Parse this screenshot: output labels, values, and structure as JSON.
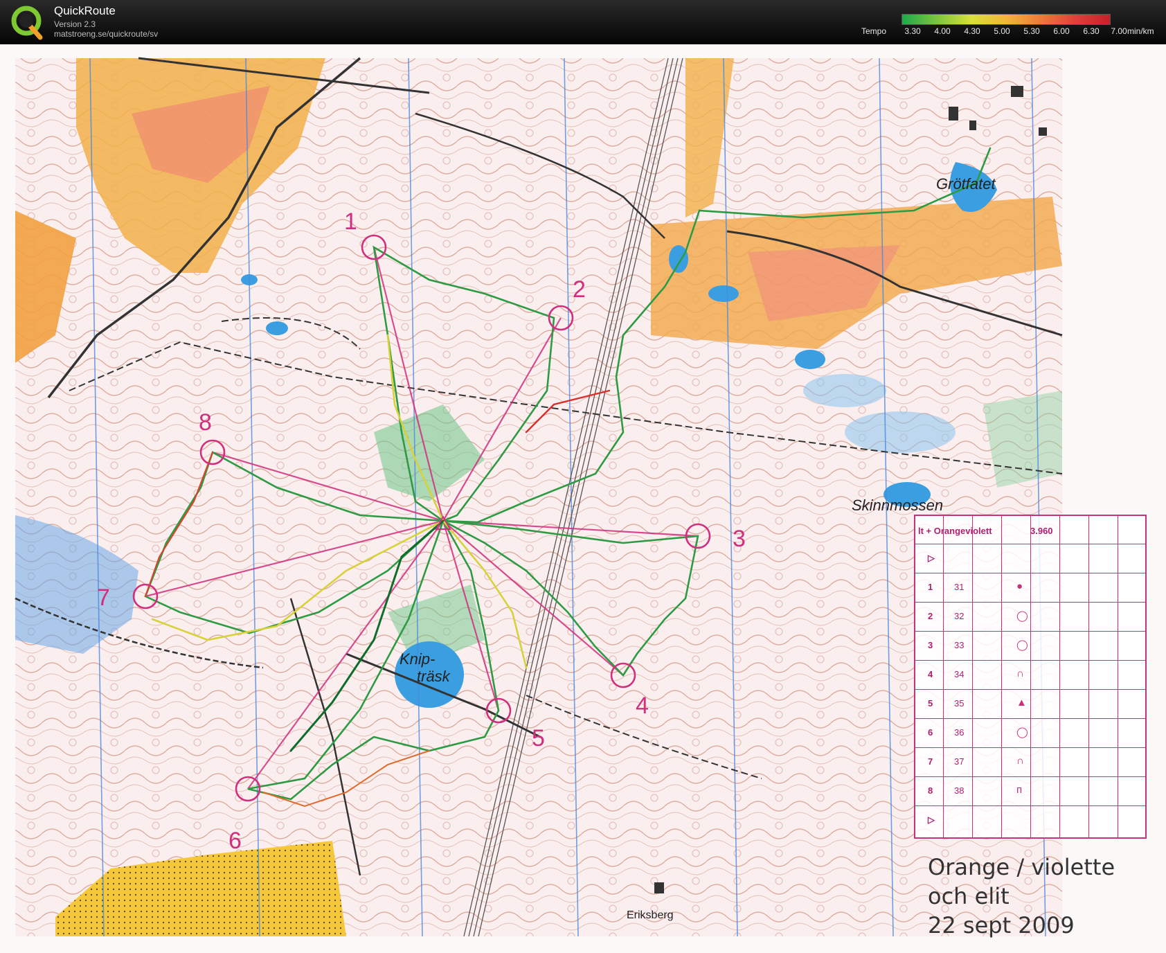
{
  "app": {
    "title": "QuickRoute",
    "version": "Version 2.3",
    "url": "matstroeng.se/quickroute/sv",
    "logo_letter": "Q"
  },
  "legend": {
    "label": "Tempo",
    "ticks": [
      "3.30",
      "4.00",
      "4.30",
      "5.00",
      "5.30",
      "6.00",
      "6.30",
      "7.00"
    ],
    "unit": "min/km",
    "colors": [
      "#1ea84a",
      "#7cc63e",
      "#d8e03a",
      "#f2b63a",
      "#ee7a3a",
      "#e0403a",
      "#c8202a"
    ]
  },
  "map": {
    "place_names": [
      "Grötfatet",
      "Skinnmossen",
      "Knip-",
      "träsk",
      "Eriksberg"
    ],
    "controls": [
      "1",
      "2",
      "3",
      "4",
      "5",
      "6",
      "7",
      "8"
    ],
    "colors": {
      "course": "#d02f7e",
      "contour": "#b85a3a",
      "water": "#3a9ee0",
      "open": "#f2b04a",
      "green": "#6cc788"
    }
  },
  "description_sheet": {
    "course": "lt + Orangeviolett",
    "length": "3.960",
    "rows": [
      {
        "num": "1",
        "code": "31",
        "sym": "●"
      },
      {
        "num": "2",
        "code": "32",
        "sym": "◯"
      },
      {
        "num": "3",
        "code": "33",
        "sym": "◯"
      },
      {
        "num": "4",
        "code": "34",
        "sym": "∩"
      },
      {
        "num": "5",
        "code": "35",
        "sym": "▲"
      },
      {
        "num": "6",
        "code": "36",
        "sym": "◯"
      },
      {
        "num": "7",
        "code": "37",
        "sym": "∩"
      },
      {
        "num": "8",
        "code": "38",
        "sym": "ᴨ"
      }
    ],
    "start_symbol": "▷",
    "finish_symbol": "▷"
  },
  "note": {
    "line1": "Orange / violette",
    "line2": "och elit",
    "line3": "22 sept  2009"
  }
}
